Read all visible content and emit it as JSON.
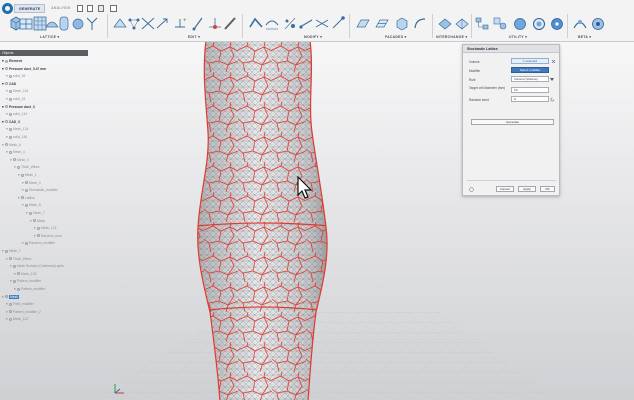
{
  "toolbar": {
    "tabs": [
      {
        "label": "GENERATE",
        "active": true
      },
      {
        "label": "ANALYSIS",
        "active": false
      }
    ],
    "groups": [
      {
        "label": "LATTICE ▾"
      },
      {
        "label": "EDIT ▾"
      },
      {
        "label": "MODIFY ▾"
      },
      {
        "label": "FACADES ▾"
      },
      {
        "label": "INTERCHANGE ▾"
      },
      {
        "label": "UTILITY ▾"
      },
      {
        "label": "BETA ▾"
      }
    ],
    "accent": "#1f6fb0"
  },
  "browser": {
    "title": "Objects",
    "items": [
      {
        "label": "Element",
        "level": 0,
        "strong": true
      },
      {
        "label": "Pressure duct_0.47 mm",
        "level": 0,
        "strong": true
      },
      {
        "label": "solid_35",
        "level": 1,
        "strong": false
      },
      {
        "label": "CAD",
        "level": 0,
        "strong": true
      },
      {
        "label": "Mesh_115",
        "level": 1,
        "strong": false
      },
      {
        "label": "solid_34",
        "level": 1,
        "strong": false
      },
      {
        "label": "Pressure duct_3",
        "level": 0,
        "strong": true
      },
      {
        "label": "solid_144",
        "level": 1,
        "strong": false
      },
      {
        "label": "CAD_3",
        "level": 0,
        "strong": true
      },
      {
        "label": "Mesh_124",
        "level": 1,
        "strong": false
      },
      {
        "label": "solid_146",
        "level": 1,
        "strong": false
      },
      {
        "label": "Mesh_6",
        "level": 0,
        "strong": false
      },
      {
        "label": "Mesh_4",
        "level": 1,
        "strong": false
      },
      {
        "label": "Mesh_3",
        "level": 2,
        "strong": false
      },
      {
        "label": "Thick_Wired",
        "level": 3,
        "strong": false
      },
      {
        "label": "Mesh_1",
        "level": 4,
        "strong": false
      },
      {
        "label": "Mesh_0",
        "level": 5,
        "strong": false
      },
      {
        "label": "Stochastic_modifier",
        "level": 5,
        "strong": false
      },
      {
        "label": "Lattice",
        "level": 4,
        "strong": false
      },
      {
        "label": "Mesh_5",
        "level": 5,
        "strong": false
      },
      {
        "label": "Mesh_7",
        "level": 6,
        "strong": false
      },
      {
        "label": "Mesh",
        "level": 7,
        "strong": false
      },
      {
        "label": "Mesh_122",
        "level": 8,
        "strong": false
      },
      {
        "label": "Random_mod",
        "level": 8,
        "strong": false
      },
      {
        "label": "Random_modifier",
        "level": 5,
        "strong": false
      },
      {
        "label": "Mesh_7",
        "level": 0,
        "strong": false
      },
      {
        "label": "Thick_Wired",
        "level": 1,
        "strong": false
      },
      {
        "label": "Mesh Surface (Conformal) optio",
        "level": 2,
        "strong": false
      },
      {
        "label": "Mesh_133",
        "level": 3,
        "strong": false
      },
      {
        "label": "Pattern_modifier",
        "level": 2,
        "strong": false
      },
      {
        "label": "Pattern_modifier",
        "level": 3,
        "strong": false
      },
      {
        "label": "Mesh",
        "level": 0,
        "strong": false,
        "selected": true
      },
      {
        "label": "Field_modifier",
        "level": 1,
        "strong": false
      },
      {
        "label": "Pattern_modifier_2",
        "level": 1,
        "strong": false
      },
      {
        "label": "Mesh_112",
        "level": 1,
        "strong": false
      }
    ]
  },
  "dialog": {
    "title": "Stochastic Lattice",
    "volume_label": "Volume",
    "volume_value": "1 selected",
    "modifier_label": "Modifier",
    "modifier_button": "Select modifier",
    "rule_label": "Rule",
    "rule_value": "Voronoi (Volume)",
    "target_label": "Target cell diameter (mm)",
    "target_value": "10",
    "seed_label": "Random seed",
    "seed_value": "0",
    "generate_label": "Generate",
    "cancel_label": "Cancel",
    "apply_label": "Apply",
    "ok_label": "OK"
  }
}
